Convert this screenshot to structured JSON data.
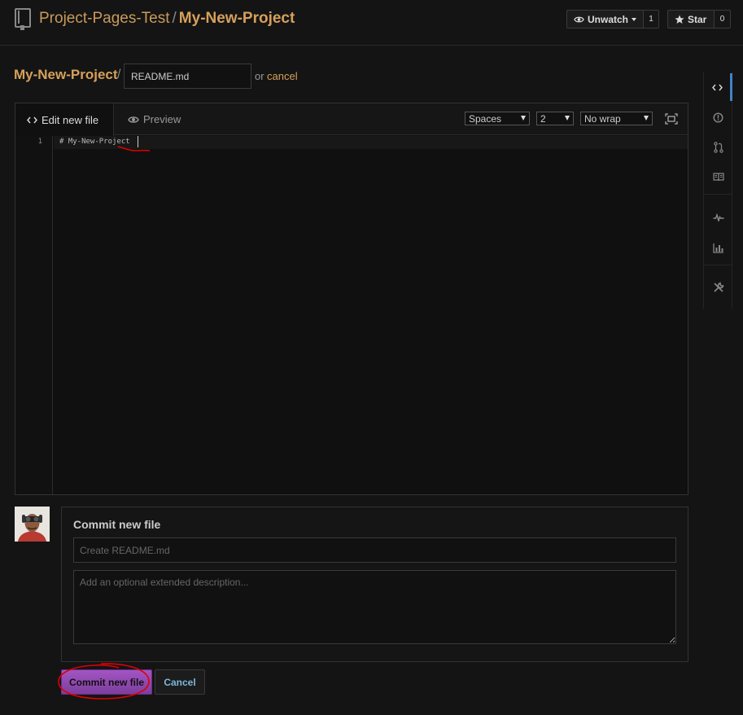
{
  "header": {
    "owner": "Project-Pages-Test",
    "separator": "/",
    "repo": "My-New-Project",
    "unwatch_label": "Unwatch",
    "watch_count": "1",
    "star_label": "Star",
    "star_count": "0"
  },
  "breadcrumb": {
    "project": "My-New-Project",
    "separator": "/",
    "filename_value": "README.md",
    "or_text": "or",
    "cancel_link": "cancel"
  },
  "editor": {
    "tabs": [
      {
        "label": "Edit new file",
        "icon": "code-icon",
        "active": true
      },
      {
        "label": "Preview",
        "icon": "eye-icon",
        "active": false
      }
    ],
    "indent_mode": "Spaces",
    "indent_size": "2",
    "wrap_mode": "No wrap",
    "lines": [
      {
        "number": "1",
        "text": "# My-New-Project"
      }
    ]
  },
  "sidenav": {
    "items": [
      {
        "icon": "code-icon",
        "active": true
      },
      {
        "icon": "issue-opened-icon",
        "active": false
      },
      {
        "icon": "pull-request-icon",
        "active": false
      },
      {
        "icon": "book-icon",
        "active": false
      },
      {
        "icon": "pulse-icon",
        "active": false
      },
      {
        "icon": "graph-icon",
        "active": false
      },
      {
        "icon": "tools-icon",
        "active": false
      }
    ]
  },
  "commit": {
    "heading": "Commit new file",
    "summary_placeholder": "Create README.md",
    "description_placeholder": "Add an optional extended description...",
    "commit_button": "Commit new file",
    "cancel_button": "Cancel"
  },
  "colors": {
    "accent": "#d7a05a",
    "commit_button": "#9b4fbf",
    "active_nav": "#4183c4",
    "annotation": "#e00000"
  }
}
